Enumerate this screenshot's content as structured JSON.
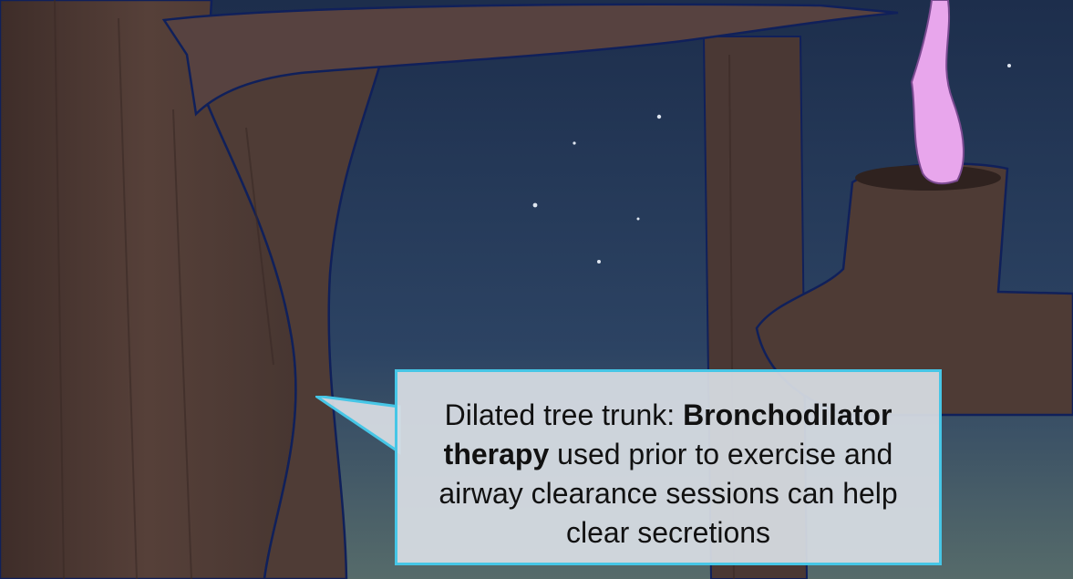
{
  "scene": {
    "description_icons": [
      "tree-trunk",
      "tree-branch",
      "pink-flame",
      "stars"
    ],
    "colors": {
      "sky_top": "#1d2e4c",
      "sky_bottom": "#566b6a",
      "bark": "#4e3b35",
      "outline": "#10205a",
      "flame": "#e8a6ec",
      "callout_border": "#46c6e6",
      "callout_fill": "#d8dee4"
    }
  },
  "callout": {
    "lead": "Dilated tree trunk: ",
    "bold": "Bronchodilator therapy",
    "rest": " used prior to exercise and airway clearance sessions can help clear secretions"
  }
}
